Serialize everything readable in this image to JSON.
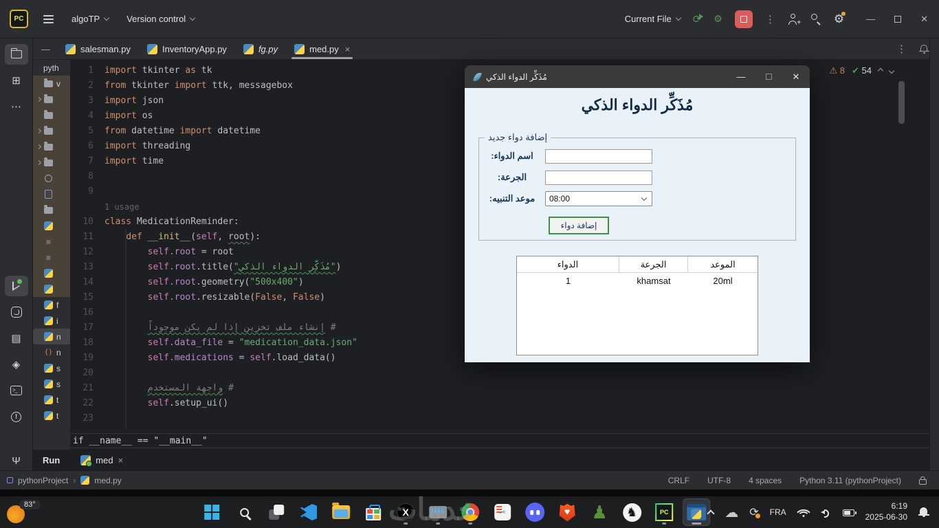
{
  "colors": {
    "accent_blue": "#3574f0",
    "stop_red": "#db5c5c",
    "run_green": "#57965c",
    "string_green": "#6aab73",
    "keyword_orange": "#cf8e6d",
    "warning_orange": "#ba8561",
    "app_body_bg": "#e9f2f9",
    "button_border_green": "#3f9043"
  },
  "ide": {
    "top": {
      "logo": "PC",
      "project": "algoTP",
      "vcs_menu": "Version control",
      "run_config": "Current File"
    },
    "tabs": [
      {
        "label": "salesman.py"
      },
      {
        "label": "InventoryApp.py"
      },
      {
        "label": "fg.py",
        "italic": true
      },
      {
        "label": "med.py",
        "active": true,
        "close": true
      }
    ],
    "inspections": {
      "warnings": "8",
      "accepted": "54"
    },
    "left_stripe": [
      "project-folder-icon",
      "structure-icon",
      "more-tools-icon",
      "run-tool-icon",
      "python-packages-icon",
      "services-icon",
      "run-anything-icon",
      "terminal-icon",
      "problems-icon",
      "version-control-branch-icon"
    ],
    "project_tree": [
      {
        "i": "root",
        "l": "pyth"
      },
      {
        "i": "folder",
        "l": "v",
        "t": 1
      },
      {
        "c": 1,
        "i": "folder",
        "t": 1
      },
      {
        "i": "folder",
        "t": 1
      },
      {
        "c": 1,
        "i": "folder",
        "t": 1
      },
      {
        "c": 1,
        "i": "folder",
        "t": 1
      },
      {
        "c": 1,
        "i": "folder",
        "t": 1
      },
      {
        "i": "circle",
        "t": 1
      },
      {
        "i": "bluefile",
        "t": 1
      },
      {
        "i": "folder",
        "t": 1
      },
      {
        "i": "python",
        "t": 1
      },
      {
        "i": "list",
        "t": 1
      },
      {
        "i": "list",
        "t": 1
      },
      {
        "i": "python",
        "t": 1
      },
      {
        "i": "python",
        "t": 1
      },
      {
        "i": "python",
        "l": "f"
      },
      {
        "i": "python",
        "l": "i"
      },
      {
        "i": "python",
        "l": "n",
        "sel": 1
      },
      {
        "i": "braces",
        "l": "n"
      },
      {
        "i": "python",
        "l": "s"
      },
      {
        "i": "python",
        "l": "s"
      },
      {
        "i": "python",
        "l": "t"
      },
      {
        "i": "python",
        "l": "t"
      }
    ],
    "editor": {
      "lines": [
        {
          "n": "1",
          "t": [
            [
              "kw",
              "import"
            ],
            [
              "pl",
              " tkinter "
            ],
            [
              "kw",
              "as"
            ],
            [
              "pl",
              " tk"
            ]
          ]
        },
        {
          "n": "2",
          "t": [
            [
              "kw",
              "from"
            ],
            [
              "pl",
              " tkinter "
            ],
            [
              "kw",
              "import"
            ],
            [
              "pl",
              " ttk, messagebox"
            ]
          ]
        },
        {
          "n": "3",
          "t": [
            [
              "kw",
              "import"
            ],
            [
              "pl",
              " json"
            ]
          ]
        },
        {
          "n": "4",
          "t": [
            [
              "kw",
              "import"
            ],
            [
              "pl",
              " os"
            ]
          ]
        },
        {
          "n": "5",
          "t": [
            [
              "kw",
              "from"
            ],
            [
              "pl",
              " datetime "
            ],
            [
              "kw",
              "import"
            ],
            [
              "pl",
              " datetime"
            ]
          ]
        },
        {
          "n": "6",
          "t": [
            [
              "kw",
              "import"
            ],
            [
              "pl",
              " threading"
            ]
          ]
        },
        {
          "n": "7",
          "t": [
            [
              "kw",
              "import"
            ],
            [
              "pl",
              " time"
            ]
          ]
        },
        {
          "n": "8",
          "t": []
        },
        {
          "n": "9",
          "t": []
        },
        {
          "n": "",
          "t": [
            [
              "us",
              "1 usage"
            ]
          ]
        },
        {
          "n": "10",
          "t": [
            [
              "kw",
              "class"
            ],
            [
              "pl",
              " MedicationReminder:"
            ]
          ]
        },
        {
          "n": "11",
          "t": [
            [
              "pl",
              "    "
            ],
            [
              "kw",
              "def"
            ],
            [
              "pl",
              " "
            ],
            [
              "fn",
              "__init__"
            ],
            [
              "pl",
              "("
            ],
            [
              "sf",
              "self"
            ],
            [
              "pl",
              ", "
            ],
            [
              "pl sqg",
              "root"
            ],
            [
              "pl",
              "):"
            ]
          ]
        },
        {
          "n": "12",
          "t": [
            [
              "pl",
              "        "
            ],
            [
              "sf",
              "self"
            ],
            [
              "at",
              ".root"
            ],
            [
              "pl",
              " = root"
            ]
          ]
        },
        {
          "n": "13",
          "t": [
            [
              "pl",
              "        "
            ],
            [
              "sf",
              "self"
            ],
            [
              "at",
              ".root"
            ],
            [
              "pl",
              ".title("
            ],
            [
              "st sq",
              "\"مُذَكِّر الدواء الذكي\""
            ],
            [
              "pl",
              ")"
            ]
          ]
        },
        {
          "n": "14",
          "t": [
            [
              "pl",
              "        "
            ],
            [
              "sf",
              "self"
            ],
            [
              "at",
              ".root"
            ],
            [
              "pl",
              ".geometry("
            ],
            [
              "st",
              "\"500x400\""
            ],
            [
              "pl",
              ")"
            ]
          ]
        },
        {
          "n": "15",
          "t": [
            [
              "pl",
              "        "
            ],
            [
              "sf",
              "self"
            ],
            [
              "at",
              ".root"
            ],
            [
              "pl",
              ".resizable("
            ],
            [
              "kw",
              "False"
            ],
            [
              "pl",
              ", "
            ],
            [
              "kw",
              "False"
            ],
            [
              "pl",
              ")"
            ]
          ]
        },
        {
          "n": "16",
          "t": []
        },
        {
          "n": "17",
          "t": [
            [
              "pl",
              "        "
            ],
            [
              "cm sq",
              "إنشاء ملف تخزين إذا لم يكن موجوداً"
            ],
            [
              "cm",
              " #"
            ]
          ]
        },
        {
          "n": "18",
          "t": [
            [
              "pl",
              "        "
            ],
            [
              "sf",
              "self"
            ],
            [
              "at",
              ".data_file"
            ],
            [
              "pl",
              " = "
            ],
            [
              "st",
              "\"medication_data.json\""
            ]
          ]
        },
        {
          "n": "19",
          "t": [
            [
              "pl",
              "        "
            ],
            [
              "sf",
              "self"
            ],
            [
              "at",
              ".medications"
            ],
            [
              "pl",
              " = "
            ],
            [
              "sf",
              "self"
            ],
            [
              "pl",
              ".load_data()"
            ]
          ]
        },
        {
          "n": "20",
          "t": []
        },
        {
          "n": "21",
          "t": [
            [
              "pl",
              "        "
            ],
            [
              "cm sq",
              "واجهة المستخدم"
            ],
            [
              "cm",
              " #"
            ]
          ]
        },
        {
          "n": "22",
          "t": [
            [
              "pl",
              "        "
            ],
            [
              "sf",
              "self"
            ],
            [
              "pl",
              ".setup_ui()"
            ]
          ]
        },
        {
          "n": "23",
          "t": []
        }
      ],
      "sticky_line": "if __name__ == \"__main__\""
    },
    "run_panel": {
      "title": "Run",
      "tab": "med"
    },
    "status_bar": {
      "project": "pythonProject",
      "file": "med.py",
      "line_ending": "CRLF",
      "encoding": "UTF-8",
      "indent": "4 spaces",
      "interpreter": "Python 3.11 (pythonProject)"
    }
  },
  "app_window": {
    "title": "مُذَكِّر الدواء الذكي",
    "heading": "مُذَكِّر الدواء الذكي",
    "form": {
      "legend": "إضافة دواء جديد",
      "fields": [
        {
          "label": "اسم الدواء:",
          "value": "",
          "type": "entry"
        },
        {
          "label": "الجرعة:",
          "value": "",
          "type": "entry"
        },
        {
          "label": "موعد التنبيه:",
          "value": "08:00",
          "type": "combobox"
        }
      ],
      "submit": "إضافة دواء"
    },
    "table": {
      "columns": [
        "الدواء",
        "الجرعة",
        "الموعد"
      ],
      "rows": [
        [
          "1",
          "khamsat",
          "20ml"
        ]
      ]
    }
  },
  "taskbar": {
    "weather": "83°",
    "icons": [
      {
        "k": "start",
        "name": "windows-start-icon"
      },
      {
        "k": "search",
        "name": "taskbar-search-icon"
      },
      {
        "k": "taskview",
        "name": "task-view-icon"
      },
      {
        "k": "vscode",
        "name": "vscode-icon"
      },
      {
        "k": "explorer",
        "name": "file-explorer-icon"
      },
      {
        "k": "store",
        "name": "microsoft-store-icon"
      },
      {
        "k": "xapp",
        "name": "x-twitter-icon",
        "running": true
      },
      {
        "k": "keyboard",
        "name": "keyboard-app-icon",
        "running": true
      },
      {
        "k": "chrome",
        "name": "chrome-icon",
        "running": true
      },
      {
        "k": "snip",
        "name": "snipping-tool-icon"
      },
      {
        "k": "discord",
        "name": "discord-icon"
      },
      {
        "k": "brave",
        "name": "brave-icon"
      },
      {
        "k": "pawn",
        "name": "chess-app-icon"
      },
      {
        "k": "lichess",
        "name": "lichess-icon"
      },
      {
        "k": "pycharm",
        "name": "pycharm-icon",
        "running": true
      },
      {
        "k": "pyapp",
        "name": "python-app-icon",
        "running": true,
        "active": true
      }
    ],
    "tray": {
      "language": "FRA",
      "time": "6:19",
      "date": "2025-06-30"
    }
  },
  "watermark": "خدمات"
}
